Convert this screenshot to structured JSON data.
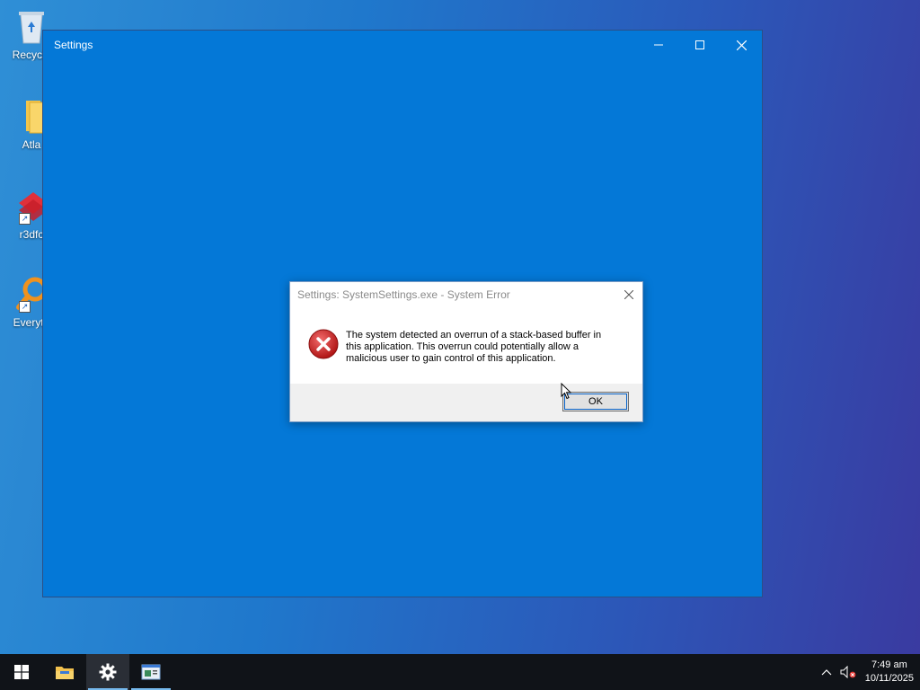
{
  "desktop": {
    "icons": [
      {
        "label": "Recycle",
        "icon": "recycle-bin-icon"
      },
      {
        "label": "Atla",
        "icon": "folder-icon"
      },
      {
        "label": "r3dfc",
        "icon": "app-shortcut-icon"
      },
      {
        "label": "Everyth",
        "icon": "search-app-icon"
      }
    ]
  },
  "settings_window": {
    "title": "Settings",
    "background": "#0478d7"
  },
  "dialog": {
    "title": "Settings: SystemSettings.exe - System Error",
    "message": "The system detected an overrun of a stack-based buffer in this application. This overrun could potentially allow a malicious user to gain control of this application.",
    "ok_label": "OK",
    "icon": "error-icon"
  },
  "taskbar": {
    "items": [
      {
        "icon": "start-icon"
      },
      {
        "icon": "file-explorer-icon"
      },
      {
        "icon": "settings-gear-icon",
        "state": "active"
      },
      {
        "icon": "app-window-icon"
      }
    ],
    "tray": {
      "time": "7:49 am",
      "date": "10/11/2025"
    }
  }
}
